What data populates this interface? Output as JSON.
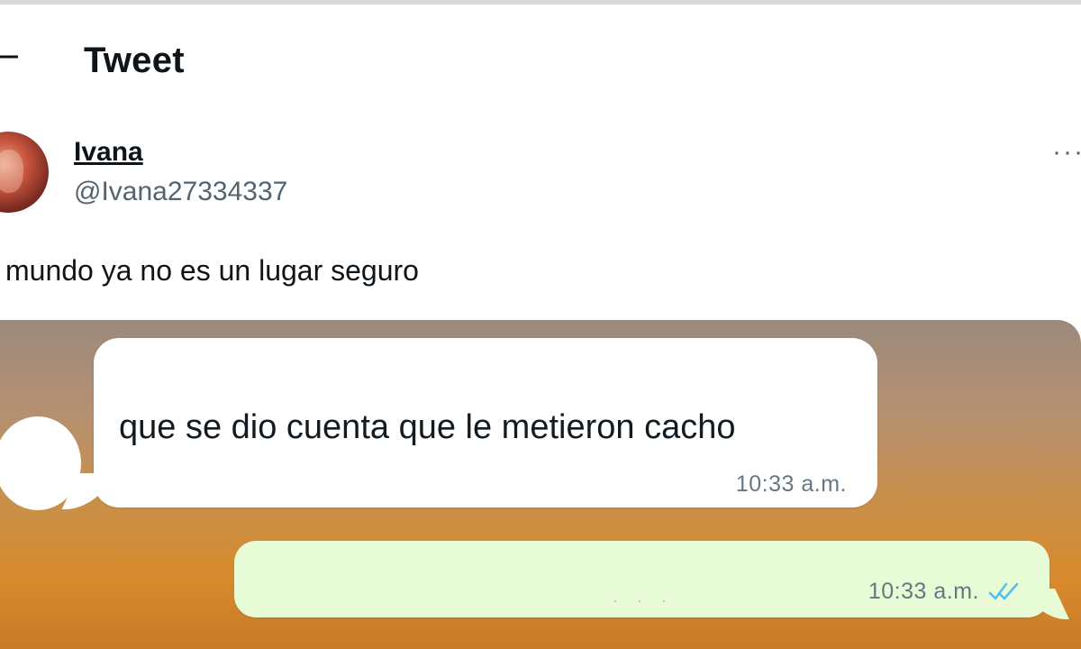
{
  "header": {
    "title": "Tweet",
    "back_icon": "arrow-left-icon"
  },
  "author": {
    "name": "Ivana",
    "handle": "@Ivana27334337",
    "more_icon": "more-horizontal-icon"
  },
  "tweet": {
    "text": "mundo ya no es un lugar seguro"
  },
  "chat": {
    "incoming": {
      "text": "que se dio cuenta que le metieron cacho",
      "time": "10:33 a.m."
    },
    "outgoing": {
      "time": "10:33 a.m.",
      "status_icon": "double-check-icon",
      "status_color": "#53bdeb",
      "bubble_color": "#e7fbd6"
    }
  }
}
